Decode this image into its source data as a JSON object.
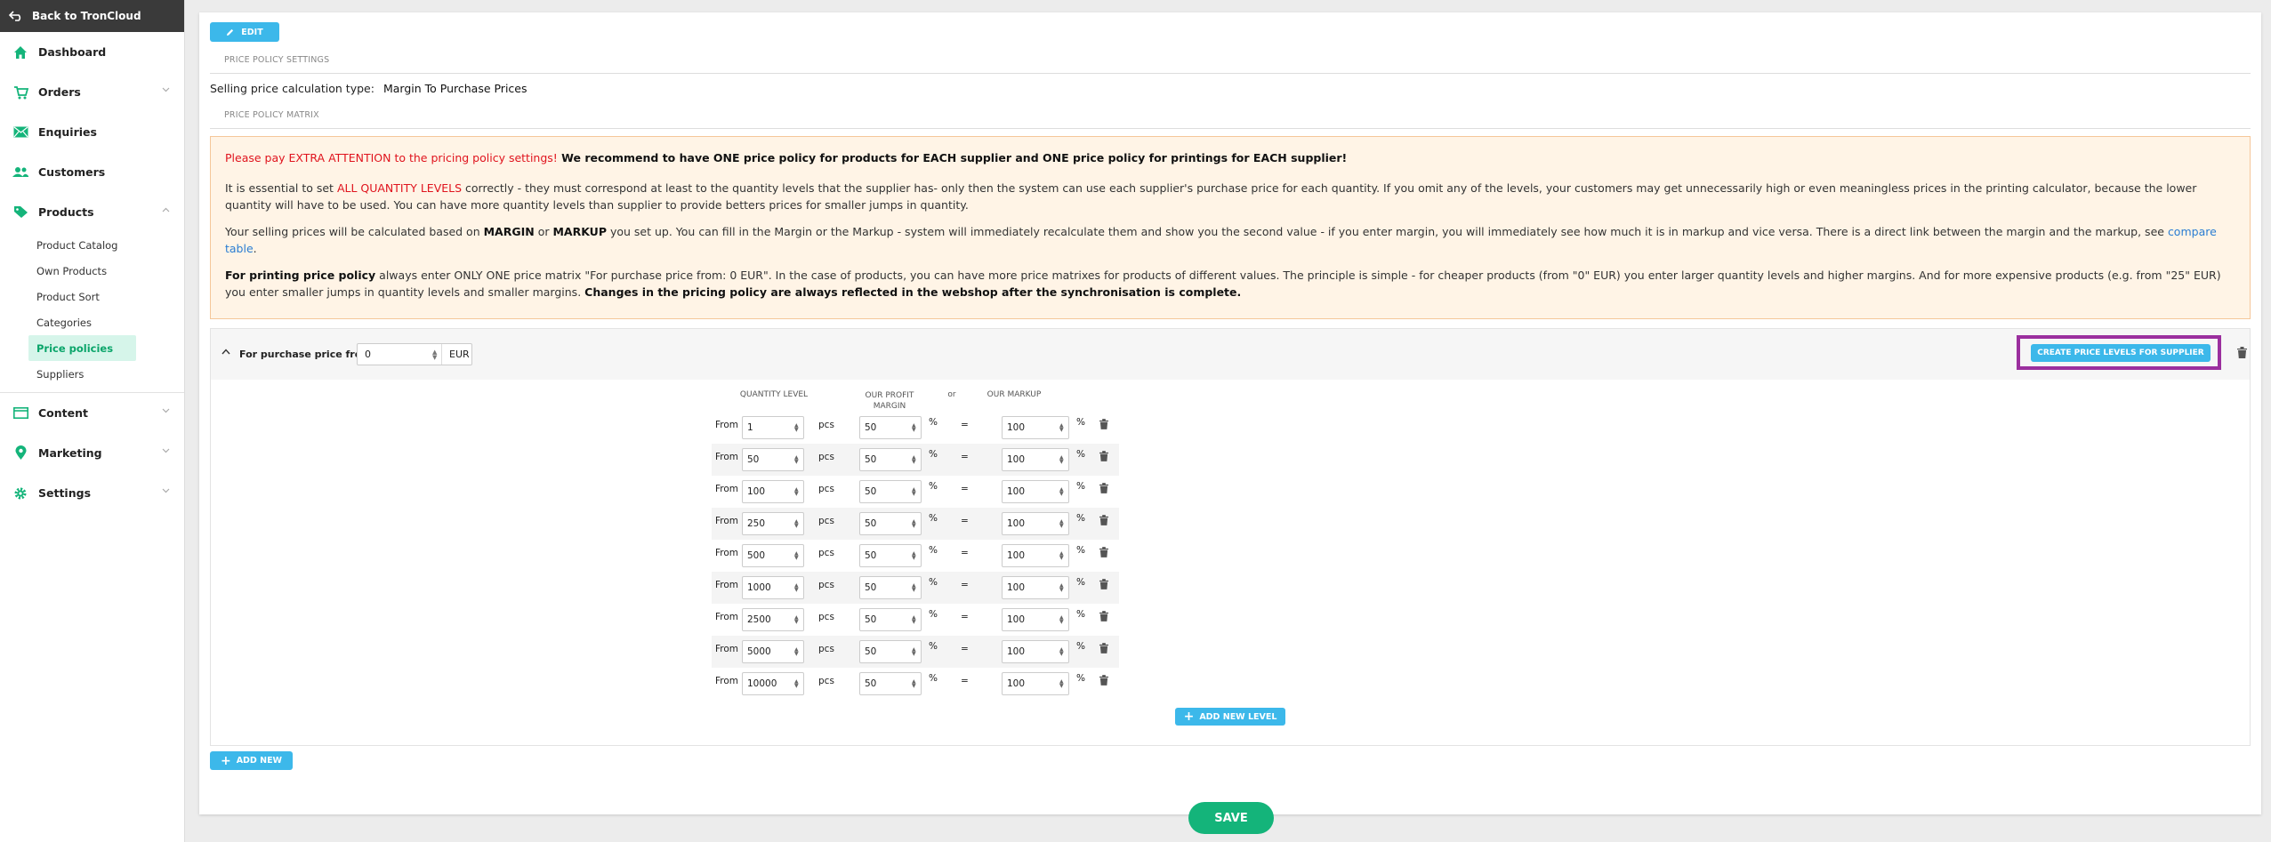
{
  "sidebar": {
    "back_label": "Back to TronCloud",
    "items": [
      {
        "label": "Dashboard",
        "icon": "home-icon",
        "has_chevron": false
      },
      {
        "label": "Orders",
        "icon": "cart-icon",
        "has_chevron": true
      },
      {
        "label": "Enquiries",
        "icon": "envelope-icon",
        "has_chevron": false
      },
      {
        "label": "Customers",
        "icon": "users-icon",
        "has_chevron": false
      },
      {
        "label": "Products",
        "icon": "tag-icon",
        "has_chevron": true,
        "expanded": true
      },
      {
        "label": "Content",
        "icon": "content-icon",
        "has_chevron": true
      },
      {
        "label": "Marketing",
        "icon": "pin-icon",
        "has_chevron": true
      },
      {
        "label": "Settings",
        "icon": "gear-icon",
        "has_chevron": true
      }
    ],
    "products_sub": [
      "Product Catalog",
      "Own Products",
      "Product Sort",
      "Categories",
      "Price policies",
      "Suppliers"
    ],
    "active_sub": "Price policies"
  },
  "main": {
    "edit_label": "EDIT",
    "settings_title": "PRICE POLICY SETTINGS",
    "calc_label": "Selling price calculation type:",
    "calc_value": "Margin To Purchase Prices",
    "matrix_title": "PRICE POLICY MATRIX"
  },
  "warning": {
    "p1_red": "Please pay EXTRA ATTENTION to the pricing policy settings!",
    "p1_bold": " We recommend to have ONE price policy for products for EACH supplier and ONE price policy for printings for EACH supplier!",
    "p2_a": "It is essential to set ",
    "p2_red": "ALL QUANTITY LEVELS",
    "p2_b": " correctly - they must correspond at least to the quantity levels that the supplier has- only then the system can use each supplier's purchase price for each quantity. If you omit any of the levels, your customers may get unnecessarily high or even meaningless prices in the printing calculator, because the lower quantity will have to be used. You can have more quantity levels than supplier to provide betters prices for smaller jumps in quantity.",
    "p3_a": "Your selling prices will be calculated based on ",
    "p3_margin": "MARGIN",
    "p3_or": " or ",
    "p3_markup": "MARKUP",
    "p3_b": " you set up. You can fill in the Margin or the Markup - system will immediately recalculate them and show you the second value - if you enter margin, you will immediately see how much it is in markup and vice versa. There is a direct link between the margin and the markup, see ",
    "p3_link": "compare table",
    "p3_end": ".",
    "p4_bold": "For printing price policy",
    "p4_a": " always enter ONLY ONE price matrix \"For purchase price from: 0 EUR\". In the case of products, you can have more price matrixes for products of different values. The principle is simple - for cheaper products (from \"0\" EUR) you enter larger quantity levels and higher margins. And for more expensive products (e.g. from \"25\" EUR) you enter smaller jumps in quantity levels and smaller margins. ",
    "p4_bold2": "Changes in the pricing policy are always reflected in the webshop after the synchronisation is complete."
  },
  "policy": {
    "label": "For purchase price from:",
    "price_value": "0",
    "currency": "EUR",
    "create_label": "CREATE PRICE LEVELS FOR SUPPLIER",
    "headers": {
      "qty": "QUANTITY LEVEL",
      "margin": "OUR PROFIT MARGIN",
      "or": "or",
      "markup": "OUR MARKUP"
    },
    "from_label": "From",
    "pcs_label": "pcs",
    "pct_label": "%",
    "eq_label": "=",
    "levels": [
      {
        "qty": "1",
        "margin": "50",
        "markup": "100"
      },
      {
        "qty": "50",
        "margin": "50",
        "markup": "100"
      },
      {
        "qty": "100",
        "margin": "50",
        "markup": "100"
      },
      {
        "qty": "250",
        "margin": "50",
        "markup": "100"
      },
      {
        "qty": "500",
        "margin": "50",
        "markup": "100"
      },
      {
        "qty": "1000",
        "margin": "50",
        "markup": "100"
      },
      {
        "qty": "2500",
        "margin": "50",
        "markup": "100"
      },
      {
        "qty": "5000",
        "margin": "50",
        "markup": "100"
      },
      {
        "qty": "10000",
        "margin": "50",
        "markup": "100"
      }
    ],
    "add_level_label": "ADD NEW LEVEL"
  },
  "add_new_label": "ADD NEW",
  "save_label": "SAVE",
  "colors": {
    "accent": "#3cb8ea",
    "green": "#14b47a",
    "highlight": "#9b2f9e",
    "warning_bg": "#fff4e6"
  }
}
